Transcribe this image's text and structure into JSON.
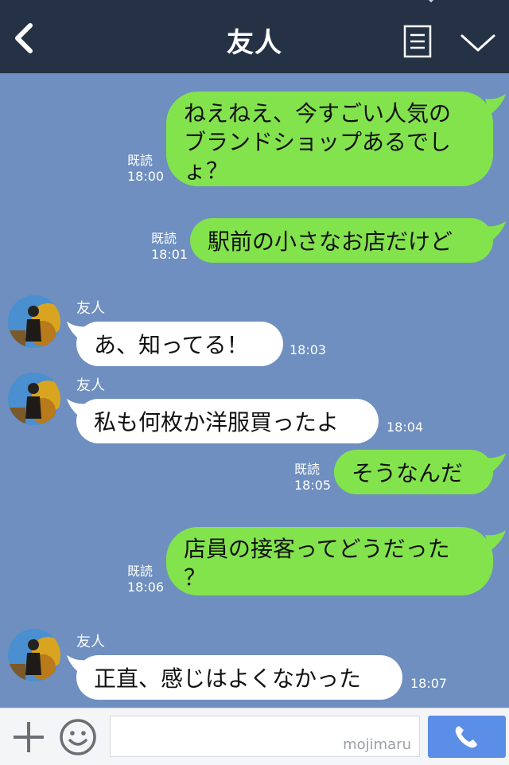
{
  "header": {
    "title": "友人",
    "back_icon": "chevron-left",
    "menu_icon": "note-list",
    "expand_icon": "chevron-down"
  },
  "messages": [
    {
      "direction": "out",
      "text": "ねえねえ、今すごい人気の\nブランドショップあるでし\nょ？",
      "read": "既読",
      "time": "18:00"
    },
    {
      "direction": "out",
      "text": "駅前の小さなお店だけど",
      "read": "既読",
      "time": "18:01"
    },
    {
      "direction": "in",
      "sender": "友人",
      "text": "あ、知ってる！",
      "time": "18:03"
    },
    {
      "direction": "in",
      "sender": "友人",
      "text": "私も何枚か洋服買ったよ",
      "time": "18:04"
    },
    {
      "direction": "out",
      "text": "そうなんだ",
      "read": "既読",
      "time": "18:05"
    },
    {
      "direction": "out",
      "text": "店員の接客ってどうだった\n？",
      "read": "既読",
      "time": "18:06"
    },
    {
      "direction": "in",
      "sender": "友人",
      "text": "正直、感じはよくなかった",
      "time": "18:07"
    }
  ],
  "input": {
    "value": "",
    "watermark": "mojimaru"
  },
  "colors": {
    "header_bg": "#253246",
    "chat_bg": "#6e8fbf",
    "outgoing_bubble": "#83e34d",
    "incoming_bubble": "#ffffff",
    "call_button": "#5b8ee6"
  }
}
